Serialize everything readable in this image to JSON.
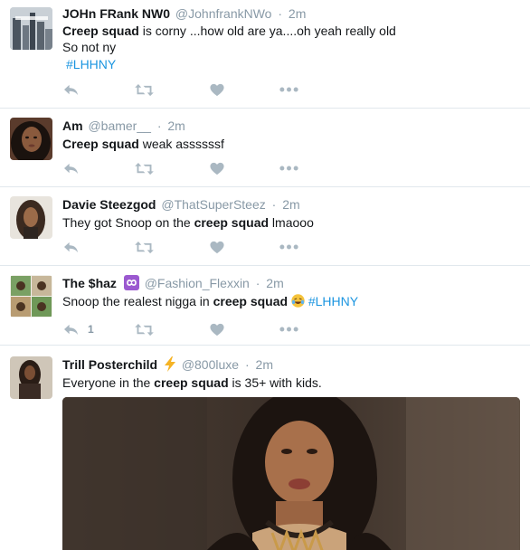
{
  "tweets": [
    {
      "fullname": "JOHn FRank NW0",
      "handle": "@JohnfrankNWo",
      "time": "2m",
      "text1_bold": "Creep squad",
      "text1_rest": " is corny ...how old are ya....oh yeah really old",
      "text2": "So not ny",
      "hashtag": "#LHHNY"
    },
    {
      "fullname": "Am",
      "handle": "@bamer__",
      "time": "2m",
      "text_bold": "Creep squad",
      "text_rest": " weak assssssf"
    },
    {
      "fullname": "Davie Steezgod",
      "handle": "@ThatSuperSteez",
      "time": "2m",
      "text_pre": "They got Snoop on the ",
      "text_bold": "creep squad",
      "text_post": " lmaooo"
    },
    {
      "fullname": "The $haz",
      "handle": "@Fashion_Flexxin",
      "time": "2m",
      "text_pre": "Snoop the realest nigga in ",
      "text_bold": "creep squad",
      "hashtag": "#LHHNY",
      "reply_count": "1"
    },
    {
      "fullname": "Trill Posterchild",
      "handle": "@800luxe",
      "time": "2m",
      "text_pre": "Everyone in the ",
      "text_bold": "creep squad",
      "text_post": " is 35+ with kids."
    }
  ],
  "separator": "·",
  "icons": {
    "reply": "reply-icon",
    "retweet": "retweet-icon",
    "like": "heart-icon",
    "more": "more-icon"
  },
  "colors": {
    "link": "#1b95e0",
    "muted": "#8899a6",
    "action": "#aab8c2",
    "divider": "#e1e8ed"
  }
}
